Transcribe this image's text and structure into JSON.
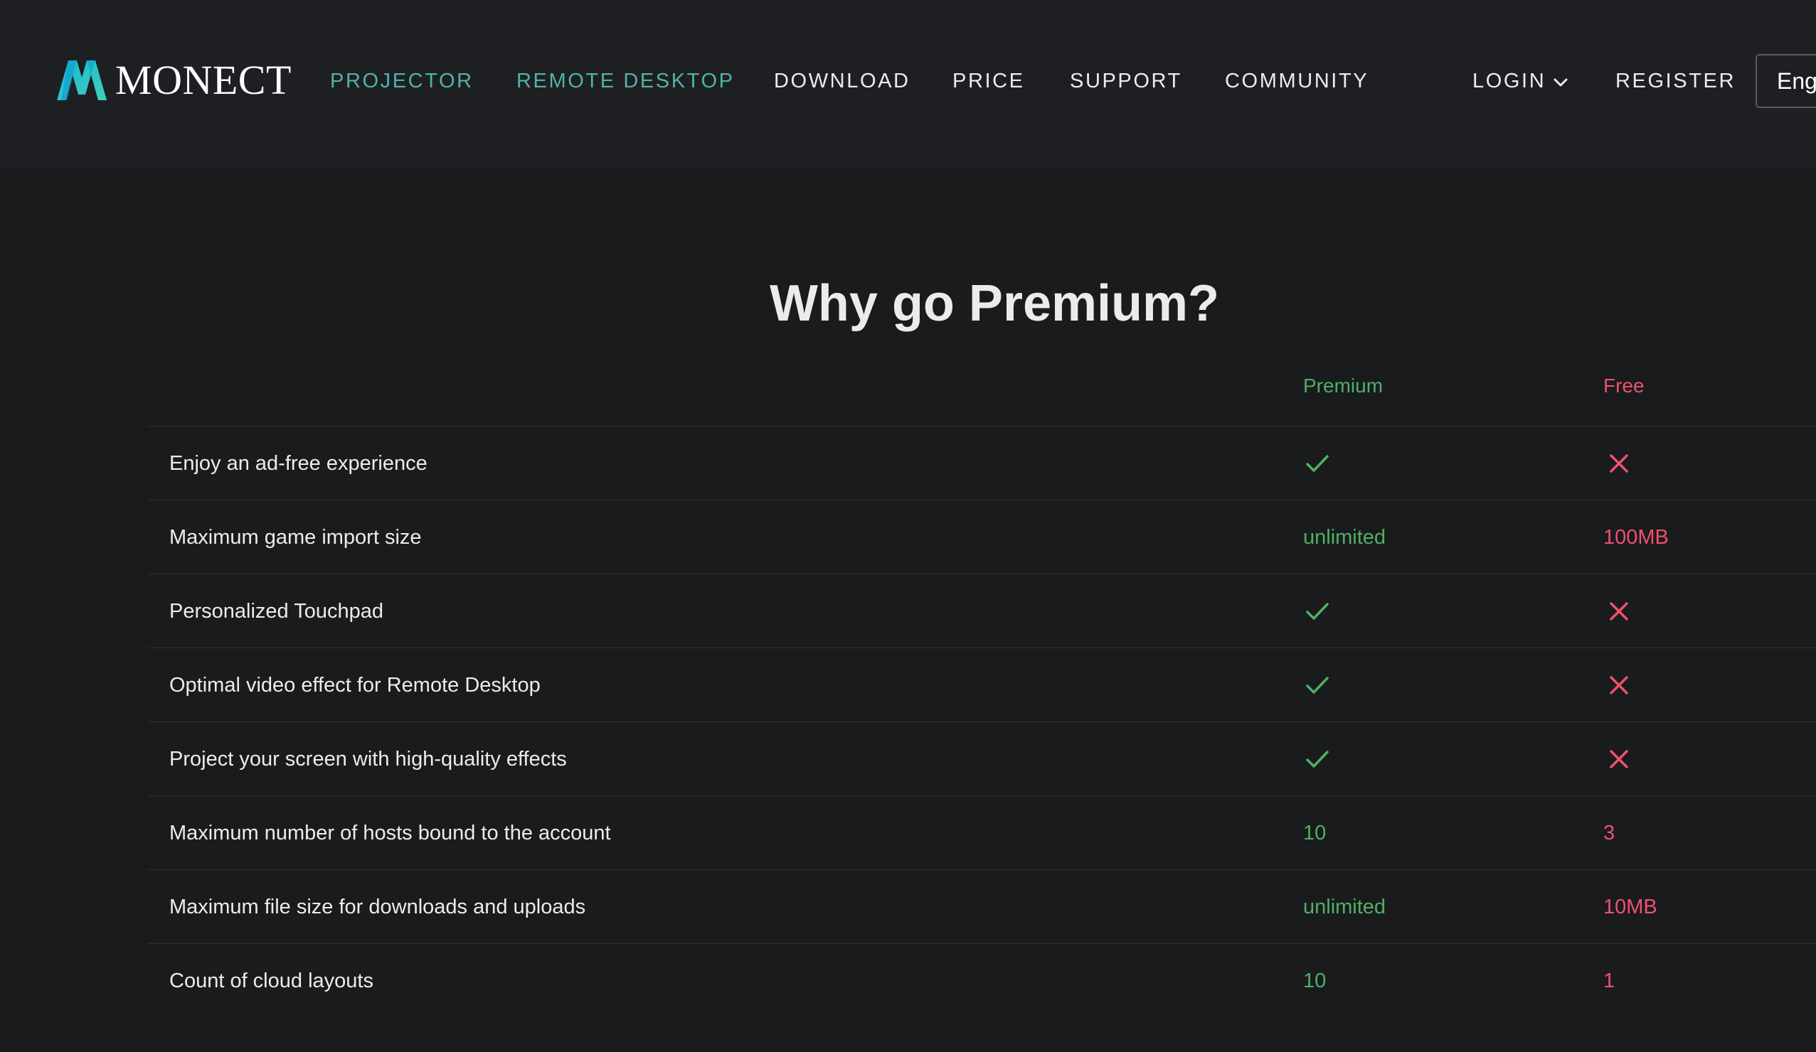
{
  "brand": {
    "name": "MONECT"
  },
  "nav": {
    "items": [
      {
        "label": "PROJECTOR"
      },
      {
        "label": "REMOTE DESKTOP"
      },
      {
        "label": "DOWNLOAD"
      },
      {
        "label": "PRICE"
      },
      {
        "label": "SUPPORT"
      },
      {
        "label": "COMMUNITY"
      }
    ],
    "login_label": "LOGIN",
    "register_label": "REGISTER",
    "language_label": "Eng"
  },
  "main": {
    "title": "Why go Premium?",
    "columns": {
      "premium": "Premium",
      "free": "Free"
    },
    "rows": [
      {
        "feature": "Enjoy an ad-free experience",
        "premium": {
          "type": "check"
        },
        "free": {
          "type": "cross"
        }
      },
      {
        "feature": "Maximum game import size",
        "premium": {
          "type": "text",
          "value": "unlimited"
        },
        "free": {
          "type": "text",
          "value": "100MB"
        }
      },
      {
        "feature": "Personalized Touchpad",
        "premium": {
          "type": "check"
        },
        "free": {
          "type": "cross"
        }
      },
      {
        "feature": "Optimal video effect for Remote Desktop",
        "premium": {
          "type": "check"
        },
        "free": {
          "type": "cross"
        }
      },
      {
        "feature": "Project your screen with high-quality effects",
        "premium": {
          "type": "check"
        },
        "free": {
          "type": "cross"
        }
      },
      {
        "feature": "Maximum number of hosts bound to the account",
        "premium": {
          "type": "text",
          "value": "10"
        },
        "free": {
          "type": "text",
          "value": "3"
        }
      },
      {
        "feature": "Maximum file size for downloads and uploads",
        "premium": {
          "type": "text",
          "value": "unlimited"
        },
        "free": {
          "type": "text",
          "value": "10MB"
        }
      },
      {
        "feature": "Count of cloud layouts",
        "premium": {
          "type": "text",
          "value": "10"
        },
        "free": {
          "type": "text",
          "value": "1"
        }
      }
    ]
  },
  "colors": {
    "background": "#1a1b1d",
    "header": "#1e1f22",
    "accent_teal": "#4fb3ab",
    "premium_green": "#4fb065",
    "free_red": "#f0506e"
  },
  "icons": {
    "logo": "monect-m-logo-icon",
    "login_caret": "chevron-down-icon",
    "premium_yes": "check-icon",
    "free_no": "cross-icon"
  }
}
